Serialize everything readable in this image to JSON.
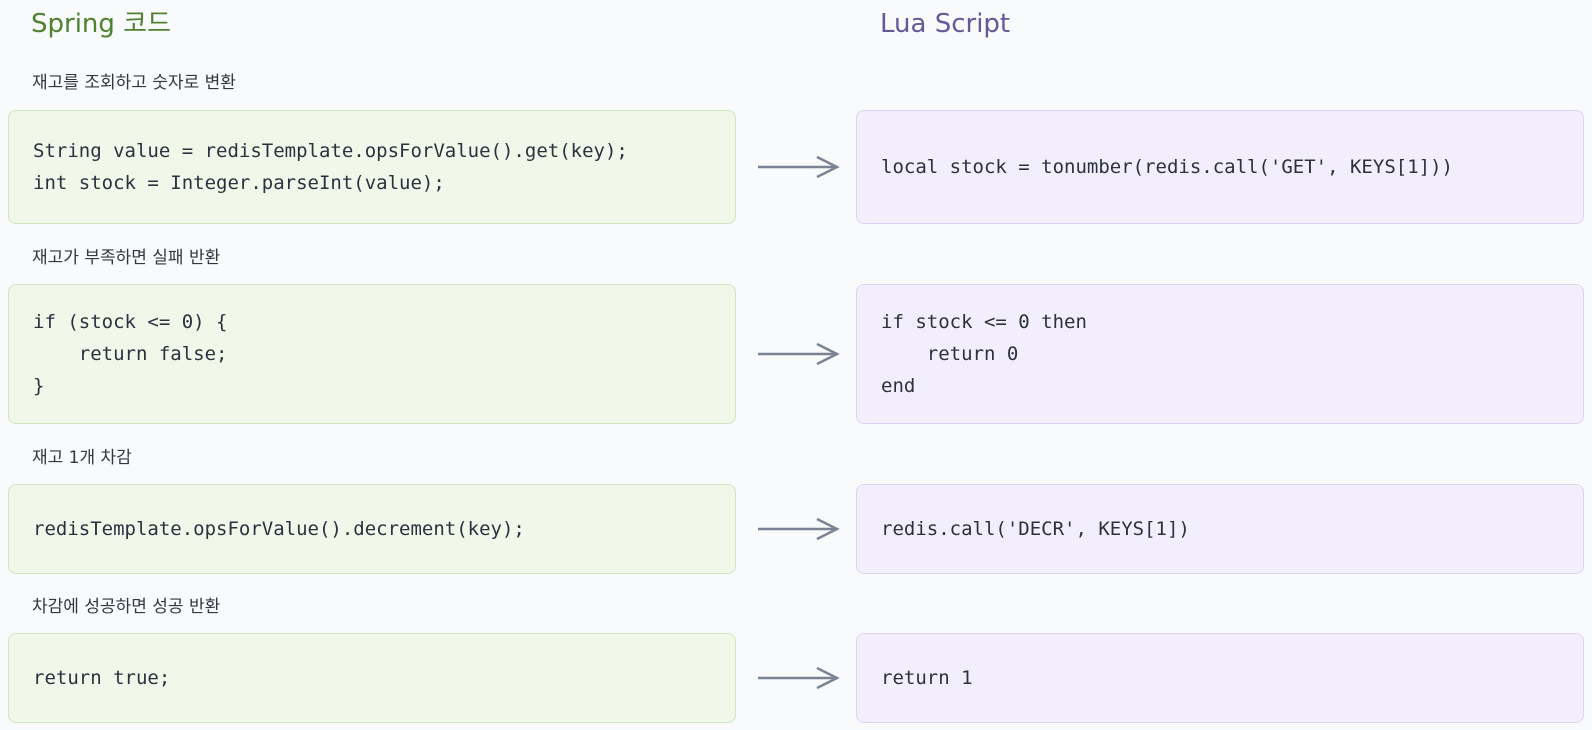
{
  "headers": {
    "spring": "Spring 코드",
    "lua": "Lua Script"
  },
  "colors": {
    "spring_title": "#4e8230",
    "lua_title": "#67589a",
    "spring_box_bg": "#f1f8ea",
    "lua_box_bg": "#f3eefc",
    "arrow": "#7a8494"
  },
  "rows": [
    {
      "label": "재고를 조회하고 숫자로 변환",
      "spring_code": "String value = redisTemplate.opsForValue().get(key);\nint stock = Integer.parseInt(value);",
      "lua_code": "local stock = tonumber(redis.call('GET', KEYS[1]))"
    },
    {
      "label": "재고가 부족하면 실패 반환",
      "spring_code": "if (stock <= 0) {\n    return false;\n}",
      "lua_code": "if stock <= 0 then\n    return 0\nend"
    },
    {
      "label": "재고 1개 차감",
      "spring_code": "redisTemplate.opsForValue().decrement(key);",
      "lua_code": "redis.call('DECR', KEYS[1])"
    },
    {
      "label": "차감에 성공하면 성공 반환",
      "spring_code": "return true;",
      "lua_code": "return 1"
    }
  ]
}
